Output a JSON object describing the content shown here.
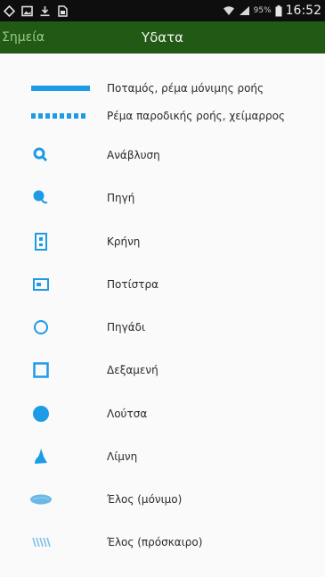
{
  "status_bar": {
    "battery_percent": "95%",
    "time": "16:52"
  },
  "app_bar": {
    "prev_tab": "Σημεία",
    "current_tab": "Υδατα"
  },
  "legend": {
    "symbol_color": "#1e9be6",
    "items": [
      {
        "label": "Ποταμός, ρέμα μόνιμης ροής",
        "icon": "solid-line-icon"
      },
      {
        "label": "Ρέμα παροδικής ροής, χείμαρρος",
        "icon": "dashed-line-icon"
      },
      {
        "label": "Ανάβλυση",
        "icon": "spring-upwelling-icon"
      },
      {
        "label": "Πηγή",
        "icon": "spring-source-icon"
      },
      {
        "label": "Κρήνη",
        "icon": "fountain-icon"
      },
      {
        "label": "Ποτίστρα",
        "icon": "water-trough-icon"
      },
      {
        "label": "Πηγάδι",
        "icon": "well-icon"
      },
      {
        "label": "Δεξαμενή",
        "icon": "reservoir-icon"
      },
      {
        "label": "Λούτσα",
        "icon": "pond-icon"
      },
      {
        "label": "Λίμνη",
        "icon": "lake-icon"
      },
      {
        "label": "Έλος (μόνιμο)",
        "icon": "permanent-marsh-icon"
      },
      {
        "label": "Έλος (πρόσκαιρο)",
        "icon": "seasonal-marsh-icon"
      }
    ]
  }
}
